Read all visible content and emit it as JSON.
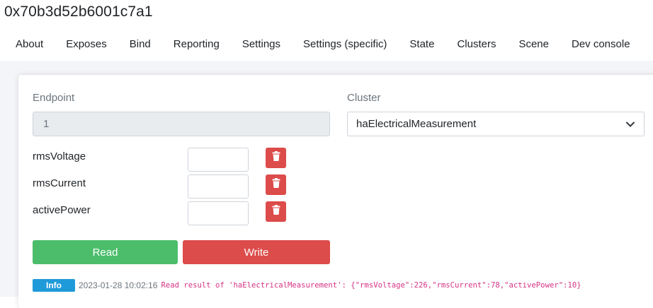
{
  "device": {
    "title": "0x70b3d52b6001c7a1"
  },
  "tabs": [
    {
      "label": "About"
    },
    {
      "label": "Exposes"
    },
    {
      "label": "Bind"
    },
    {
      "label": "Reporting"
    },
    {
      "label": "Settings"
    },
    {
      "label": "Settings (specific)"
    },
    {
      "label": "State"
    },
    {
      "label": "Clusters"
    },
    {
      "label": "Scene"
    },
    {
      "label": "Dev console",
      "active": true
    }
  ],
  "form": {
    "endpoint_label": "Endpoint",
    "endpoint_value": "1",
    "cluster_label": "Cluster",
    "cluster_value": "haElectricalMeasurement"
  },
  "attributes": [
    {
      "name": "rmsVoltage",
      "value": ""
    },
    {
      "name": "rmsCurrent",
      "value": ""
    },
    {
      "name": "activePower",
      "value": ""
    }
  ],
  "actions": {
    "read_label": "Read",
    "write_label": "Write"
  },
  "log": {
    "level": "Info",
    "timestamp": "2023-01-28 10:02:16",
    "message": "Read result of 'haElectricalMeasurement': {\"rmsVoltage\":226,\"rmsCurrent\":78,\"activePower\":10}"
  },
  "colors": {
    "read": "#4cbe6b",
    "write": "#dc4c4a",
    "delete": "#dc4c4a",
    "info": "#1f9ad9",
    "log_text": "#d63384"
  },
  "icons": {
    "delete": "trash-icon",
    "dropdown": "chevron-down-icon"
  }
}
